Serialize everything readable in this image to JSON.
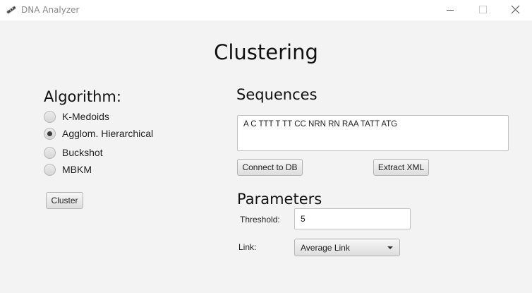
{
  "window": {
    "title": "DNA Analyzer",
    "icon": "dna-app-icon",
    "controls": [
      "minimize-icon",
      "maximize-icon",
      "close-icon"
    ]
  },
  "heading": "Clustering",
  "algorithm": {
    "label": "Algorithm:",
    "options": [
      {
        "label": "K-Medoids",
        "selected": false
      },
      {
        "label": "Agglom. Hierarchical",
        "selected": true
      },
      {
        "label": "Buckshot",
        "selected": false
      },
      {
        "label": "MBKM",
        "selected": false
      }
    ],
    "cluster_button": "Cluster"
  },
  "sequences": {
    "label": "Sequences",
    "value": "A C TTT T TT CC NRN RN RAA TATT ATG",
    "connect_button": "Connect to DB",
    "extract_button": "Extract XML"
  },
  "parameters": {
    "label": "Parameters",
    "threshold_label": "Threshold:",
    "threshold_value": "5",
    "link_label": "Link:",
    "link_value": "Average Link"
  }
}
